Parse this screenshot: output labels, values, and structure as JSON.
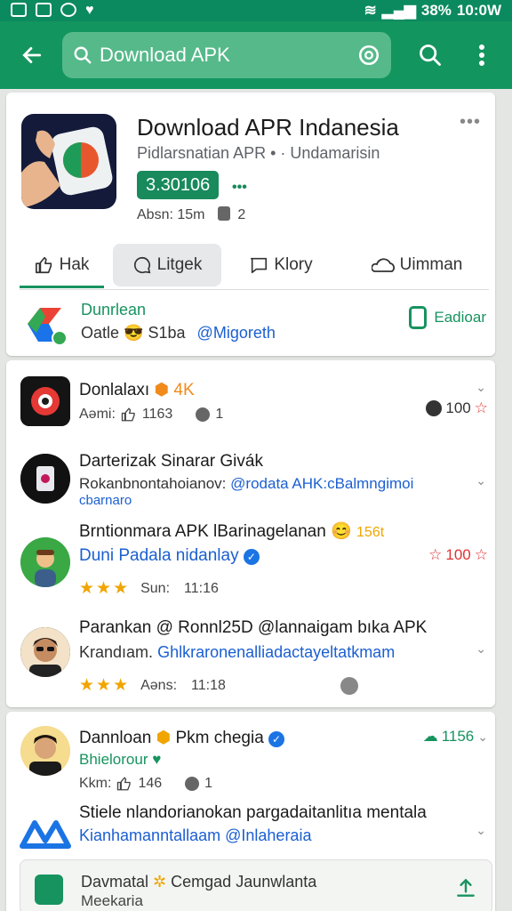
{
  "status_bar": {
    "battery": "38%",
    "time": "10:0W"
  },
  "search": {
    "query": "Download APK"
  },
  "app": {
    "title": "Download APR Indanesia",
    "subtitle": "Pidlarsnatian APR • · Undamarisin",
    "badge": "3.30106",
    "meta_label": "Absn: 15m",
    "meta_count": "2"
  },
  "tabs": [
    {
      "label": "Hak",
      "icon": "thumb-up-icon"
    },
    {
      "label": "Litgek",
      "icon": "chat-bubble-icon"
    },
    {
      "label": "Klory",
      "icon": "comment-icon"
    },
    {
      "label": "Uimman",
      "icon": "cloud-icon"
    }
  ],
  "promo": {
    "title": "Dunrlean",
    "sub": "Oatle",
    "sub2": "S1ba",
    "handle": "@Migoreth",
    "button": "Eadioar"
  },
  "rows": [
    {
      "title": "Donlalaxı",
      "tag": "4K",
      "meta": "Aəmi:",
      "likes": "1163",
      "count": "1",
      "rating": "100"
    },
    {
      "title": "Darterizak Sinarar Givák",
      "sub": "Rokanbnontahoianov:",
      "link": "@rodata AHK:cBalmngimoi",
      "link2": "cbarnaro"
    },
    {
      "title": "Brntionmara APK lBarinagelanan",
      "emoji": "😊",
      "tag": "156t",
      "link": "Duni Padala nidanlay",
      "stars": "★★★",
      "meta": "Sun:",
      "time": "11:16",
      "rating": "100"
    },
    {
      "title": "Parankan @ Ronnl25D @lannaigam bıka APK",
      "sub": "Krandıam.",
      "link": "Ghlkraronenalliadactayeltatkmam",
      "stars": "★★★",
      "meta": "Aəns:",
      "time": "11:18"
    },
    {
      "title": "Dannloan",
      "title2": "Pkm chegia",
      "sub_green": "Bhielorour",
      "meta": "Kkm:",
      "likes": "146",
      "count": "1",
      "rating": "1156"
    },
    {
      "title": "Stiele nlandorianokan pargadaitanlitıa mentala",
      "sub": "Kianhamanntallaam",
      "link": "@Inlaheraia"
    }
  ],
  "cta": {
    "title": "Davmatal",
    "title2": "Cemgad Jaunwlanta",
    "sub": "Meekaria"
  }
}
